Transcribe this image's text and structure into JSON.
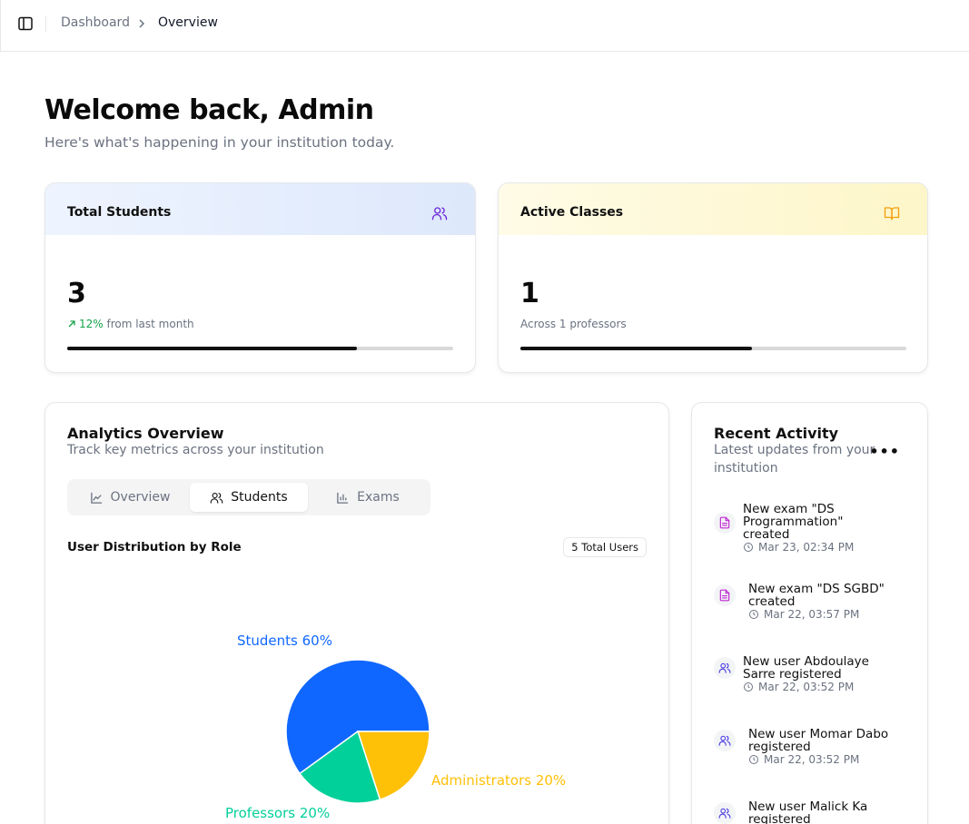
{
  "header": {
    "breadcrumb": [
      "Dashboard",
      "Overview"
    ]
  },
  "page": {
    "title": "Welcome back, Admin",
    "subtitle": "Here's what's happening in your institution today."
  },
  "stats": [
    {
      "title": "Total Students",
      "value": "3",
      "trend": "12%",
      "note": " from last month",
      "progress": 0.75,
      "icon": "users-icon",
      "accent": "#6d28d9"
    },
    {
      "title": "Active Classes",
      "value": "1",
      "note": "Across 1 professors",
      "progress": 0.6,
      "icon": "book-open-icon",
      "accent": "#f59e0b"
    }
  ],
  "analytics": {
    "title": "Analytics Overview",
    "subtitle": "Track key metrics across your institution",
    "tabs": [
      {
        "label": "Overview",
        "icon": "line-chart-icon",
        "active": false
      },
      {
        "label": "Students",
        "icon": "users-icon",
        "active": true
      },
      {
        "label": "Exams",
        "icon": "bar-chart-icon",
        "active": false
      }
    ],
    "chart_title": "User Distribution by Role",
    "total_badge": "5 Total Users"
  },
  "chart_data": {
    "type": "pie",
    "title": "User Distribution by Role",
    "categories": [
      "Students",
      "Administrators",
      "Professors"
    ],
    "values": [
      60,
      20,
      20
    ],
    "labels": [
      "Students 60%",
      "Administrators 20%",
      "Professors 20%"
    ],
    "colors": [
      "#1067ff",
      "#ffc008",
      "#02d09a"
    ]
  },
  "activity": {
    "title": "Recent Activity",
    "subtitle": "Latest updates from your institution",
    "items": [
      {
        "text": "New exam \"DS Programmation\" created",
        "time": "Mar 23, 02:34 PM",
        "icon": "file-text-icon"
      },
      {
        "text": "New exam \"DS SGBD\" created",
        "time": "Mar 22, 03:57 PM",
        "icon": "file-text-icon"
      },
      {
        "text": "New user Abdoulaye Sarre registered",
        "time": "Mar 22, 03:52 PM",
        "icon": "users-icon"
      },
      {
        "text": "New user Momar Dabo registered",
        "time": "Mar 22, 03:52 PM",
        "icon": "users-icon"
      },
      {
        "text": "New user Malick Ka registered",
        "time": "",
        "icon": "users-icon"
      }
    ]
  }
}
